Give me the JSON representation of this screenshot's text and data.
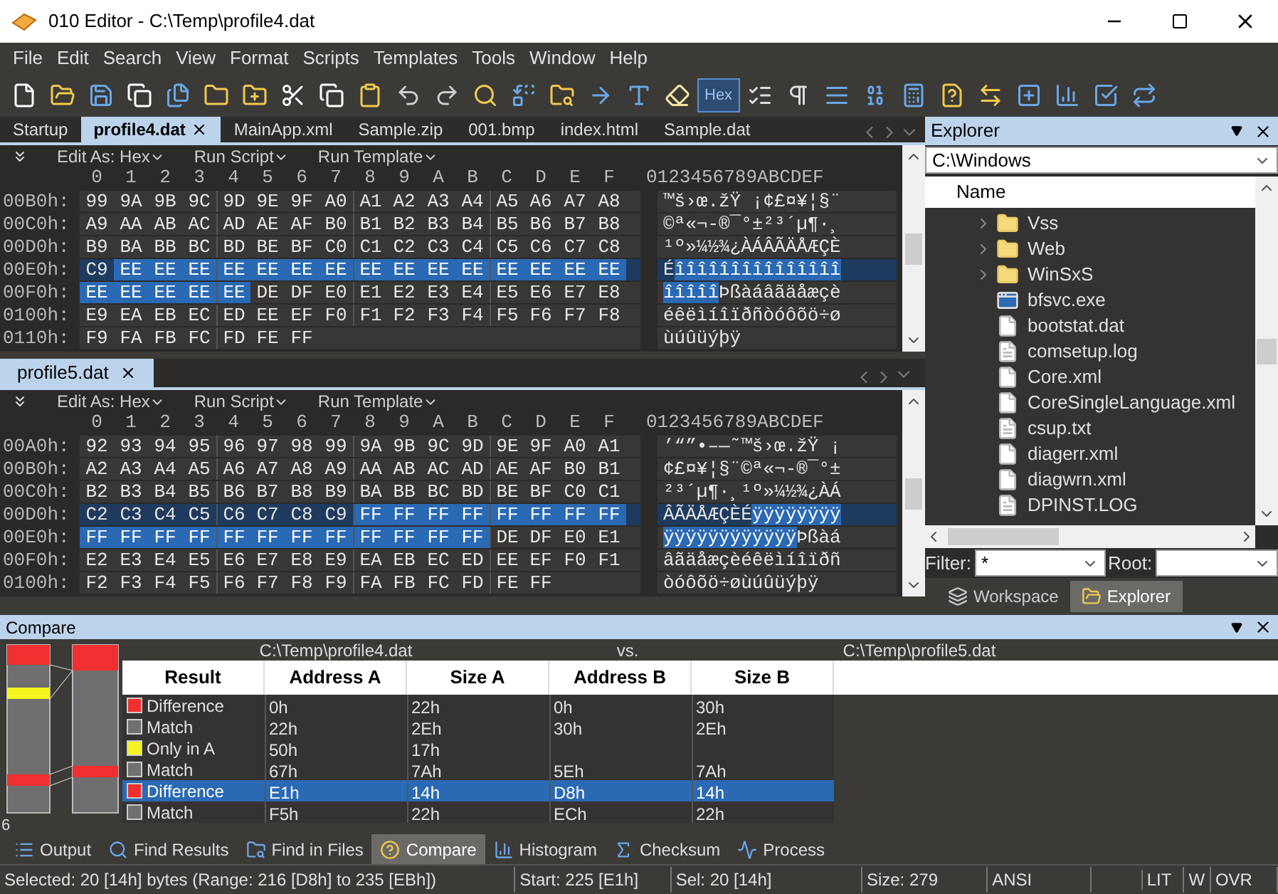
{
  "window": {
    "title": "010 Editor - C:\\Temp\\profile4.dat"
  },
  "menu": [
    "File",
    "Edit",
    "Search",
    "View",
    "Format",
    "Scripts",
    "Templates",
    "Tools",
    "Window",
    "Help"
  ],
  "toolbar": {
    "hex_toggle": {
      "label": "Hex",
      "selected": true
    }
  },
  "file_tabs": [
    {
      "label": "Startup",
      "selected": false
    },
    {
      "label": "profile4.dat",
      "selected": true
    },
    {
      "label": "MainApp.xml",
      "selected": false
    },
    {
      "label": "Sample.zip",
      "selected": false
    },
    {
      "label": "001.bmp",
      "selected": false
    },
    {
      "label": "index.html",
      "selected": false
    },
    {
      "label": "Sample.dat",
      "selected": false
    }
  ],
  "editors": [
    {
      "toolbar": [
        "Edit As: Hex",
        "Run Script",
        "Run Template"
      ],
      "columns": [
        "0",
        "1",
        "2",
        "3",
        "4",
        "5",
        "6",
        "7",
        "8",
        "9",
        "A",
        "B",
        "C",
        "D",
        "E",
        "F"
      ],
      "ascii_header": "0123456789ABCDEF",
      "rows": [
        {
          "address": "00B0h:",
          "current": false,
          "before": [
            "99",
            "9A",
            "9B",
            "9C",
            "9D",
            "9E",
            "9F",
            "A0",
            "A1",
            "A2",
            "A3",
            "A4",
            "A5",
            "A6",
            "A7",
            "A8"
          ],
          "highlighted": [],
          "after": [],
          "ascii_before": "™š›œ.žŸ ¡¢£¤¥¦§¨",
          "ascii_highlighted": "",
          "ascii_after": ""
        },
        {
          "address": "00C0h:",
          "current": false,
          "before": [
            "A9",
            "AA",
            "AB",
            "AC",
            "AD",
            "AE",
            "AF",
            "B0",
            "B1",
            "B2",
            "B3",
            "B4",
            "B5",
            "B6",
            "B7",
            "B8"
          ],
          "highlighted": [],
          "after": [],
          "ascii_before": "©ª«¬-®¯°±²³´µ¶·¸",
          "ascii_highlighted": "",
          "ascii_after": ""
        },
        {
          "address": "00D0h:",
          "current": false,
          "before": [
            "B9",
            "BA",
            "BB",
            "BC",
            "BD",
            "BE",
            "BF",
            "C0",
            "C1",
            "C2",
            "C3",
            "C4",
            "C5",
            "C6",
            "C7",
            "C8"
          ],
          "highlighted": [],
          "after": [],
          "ascii_before": "¹º»¼½¾¿ÀÁÂÃÄÅÆÇÈ",
          "ascii_highlighted": "",
          "ascii_after": ""
        },
        {
          "address": "00E0h:",
          "current": true,
          "before": [
            "C9"
          ],
          "highlighted": [
            "EE",
            "EE",
            "EE",
            "EE",
            "EE",
            "EE",
            "EE",
            "EE",
            "EE",
            "EE",
            "EE",
            "EE",
            "EE",
            "EE",
            "EE"
          ],
          "after": [],
          "ascii_before": "É",
          "ascii_highlighted": "îîîîîîîîîîîîîîî",
          "ascii_after": ""
        },
        {
          "address": "00F0h:",
          "current": false,
          "before": [],
          "highlighted": [
            "EE",
            "EE",
            "EE",
            "EE",
            "EE"
          ],
          "after": [
            "DE",
            "DF",
            "E0",
            "E1",
            "E2",
            "E3",
            "E4",
            "E5",
            "E6",
            "E7",
            "E8"
          ],
          "ascii_before": "",
          "ascii_highlighted": "îîîîî",
          "ascii_after": "Þßàáâãäåæçè"
        },
        {
          "address": "0100h:",
          "current": false,
          "before": [
            "E9",
            "EA",
            "EB",
            "EC",
            "ED",
            "EE",
            "EF",
            "F0",
            "F1",
            "F2",
            "F3",
            "F4",
            "F5",
            "F6",
            "F7",
            "F8"
          ],
          "highlighted": [],
          "after": [],
          "ascii_before": "éêëìíîïðñòóôõö÷ø",
          "ascii_highlighted": "",
          "ascii_after": ""
        },
        {
          "address": "0110h:",
          "current": false,
          "before": [
            "F9",
            "FA",
            "FB",
            "FC",
            "FD",
            "FE",
            "FF"
          ],
          "highlighted": [],
          "after": [],
          "ascii_before": "ùúûüýþÿ",
          "ascii_highlighted": "",
          "ascii_after": ""
        }
      ]
    },
    {
      "tab": {
        "label": "profile5.dat",
        "selected": true
      },
      "toolbar": [
        "Edit As: Hex",
        "Run Script",
        "Run Template"
      ],
      "columns": [
        "0",
        "1",
        "2",
        "3",
        "4",
        "5",
        "6",
        "7",
        "8",
        "9",
        "A",
        "B",
        "C",
        "D",
        "E",
        "F"
      ],
      "ascii_header": "0123456789ABCDEF",
      "rows": [
        {
          "address": "00A0h:",
          "current": false,
          "before": [
            "92",
            "93",
            "94",
            "95",
            "96",
            "97",
            "98",
            "99",
            "9A",
            "9B",
            "9C",
            "9D",
            "9E",
            "9F",
            "A0",
            "A1"
          ],
          "highlighted": [],
          "after": [],
          "ascii_before": "’“”•–—˜™š›œ.žŸ ¡",
          "ascii_highlighted": "",
          "ascii_after": ""
        },
        {
          "address": "00B0h:",
          "current": false,
          "before": [
            "A2",
            "A3",
            "A4",
            "A5",
            "A6",
            "A7",
            "A8",
            "A9",
            "AA",
            "AB",
            "AC",
            "AD",
            "AE",
            "AF",
            "B0",
            "B1"
          ],
          "highlighted": [],
          "after": [],
          "ascii_before": "¢£¤¥¦§¨©ª«¬-®¯°±",
          "ascii_highlighted": "",
          "ascii_after": ""
        },
        {
          "address": "00C0h:",
          "current": false,
          "before": [
            "B2",
            "B3",
            "B4",
            "B5",
            "B6",
            "B7",
            "B8",
            "B9",
            "BA",
            "BB",
            "BC",
            "BD",
            "BE",
            "BF",
            "C0",
            "C1"
          ],
          "highlighted": [],
          "after": [],
          "ascii_before": "²³´µ¶·¸¹º»¼½¾¿ÀÁ",
          "ascii_highlighted": "",
          "ascii_after": ""
        },
        {
          "address": "00D0h:",
          "current": true,
          "before": [
            "C2",
            "C3",
            "C4",
            "C5",
            "C6",
            "C7",
            "C8",
            "C9"
          ],
          "highlighted": [
            "FF",
            "FF",
            "FF",
            "FF",
            "FF",
            "FF",
            "FF",
            "FF"
          ],
          "after": [],
          "ascii_before": "ÂÃÄÅÆÇÈÉ",
          "ascii_highlighted": "ÿÿÿÿÿÿÿÿ",
          "ascii_after": ""
        },
        {
          "address": "00E0h:",
          "current": false,
          "before": [],
          "highlighted": [
            "FF",
            "FF",
            "FF",
            "FF",
            "FF",
            "FF",
            "FF",
            "FF",
            "FF",
            "FF",
            "FF",
            "FF"
          ],
          "after": [
            "DE",
            "DF",
            "E0",
            "E1"
          ],
          "ascii_before": "",
          "ascii_highlighted": "ÿÿÿÿÿÿÿÿÿÿÿÿ",
          "ascii_after": "Þßàá"
        },
        {
          "address": "00F0h:",
          "current": false,
          "before": [
            "E2",
            "E3",
            "E4",
            "E5",
            "E6",
            "E7",
            "E8",
            "E9",
            "EA",
            "EB",
            "EC",
            "ED",
            "EE",
            "EF",
            "F0",
            "F1"
          ],
          "highlighted": [],
          "after": [],
          "ascii_before": "âãäåæçèéêëìíîïðñ",
          "ascii_highlighted": "",
          "ascii_after": ""
        },
        {
          "address": "0100h:",
          "current": false,
          "before": [
            "F2",
            "F3",
            "F4",
            "F5",
            "F6",
            "F7",
            "F8",
            "F9",
            "FA",
            "FB",
            "FC",
            "FD",
            "FE",
            "FF"
          ],
          "highlighted": [],
          "after": [],
          "ascii_before": "òóôõö÷øùúûüýþÿ",
          "ascii_highlighted": "",
          "ascii_after": ""
        }
      ]
    }
  ],
  "explorer": {
    "title": "Explorer",
    "path": "C:\\Windows",
    "column": "Name",
    "items": [
      {
        "name": "Vss",
        "kind": "folder"
      },
      {
        "name": "Web",
        "kind": "folder"
      },
      {
        "name": "WinSxS",
        "kind": "folder"
      },
      {
        "name": "bfsvc.exe",
        "kind": "app"
      },
      {
        "name": "bootstat.dat",
        "kind": "file"
      },
      {
        "name": "comsetup.log",
        "kind": "text"
      },
      {
        "name": "Core.xml",
        "kind": "file"
      },
      {
        "name": "CoreSingleLanguage.xml",
        "kind": "file"
      },
      {
        "name": "csup.txt",
        "kind": "text"
      },
      {
        "name": "diagerr.xml",
        "kind": "file"
      },
      {
        "name": "diagwrn.xml",
        "kind": "file"
      },
      {
        "name": "DPINST.LOG",
        "kind": "text"
      }
    ],
    "filter_label": "Filter:",
    "filter_value": "*",
    "root_label": "Root:",
    "tabs": [
      {
        "label": "Workspace",
        "selected": false
      },
      {
        "label": "Explorer",
        "selected": true
      }
    ]
  },
  "compare": {
    "title": "Compare",
    "file_a": "C:\\Temp\\profile4.dat",
    "vs": "vs.",
    "file_b": "C:\\Temp\\profile5.dat",
    "columns": [
      "Result",
      "Address A",
      "Size A",
      "Address B",
      "Size B"
    ],
    "rows": [
      {
        "result": "Difference",
        "color": "#f03030",
        "address_a": "0h",
        "size_a": "22h",
        "address_b": "0h",
        "size_b": "30h",
        "selected": false
      },
      {
        "result": "Match",
        "color": "#707070",
        "address_a": "22h",
        "size_a": "2Eh",
        "address_b": "30h",
        "size_b": "2Eh",
        "selected": false
      },
      {
        "result": "Only in A",
        "color": "#f5f520",
        "address_a": "50h",
        "size_a": "17h",
        "address_b": "",
        "size_b": "",
        "selected": false
      },
      {
        "result": "Match",
        "color": "#707070",
        "address_a": "67h",
        "size_a": "7Ah",
        "address_b": "5Eh",
        "size_b": "7Ah",
        "selected": false
      },
      {
        "result": "Difference",
        "color": "#f03030",
        "address_a": "E1h",
        "size_a": "14h",
        "address_b": "D8h",
        "size_b": "14h",
        "selected": true
      },
      {
        "result": "Match",
        "color": "#707070",
        "address_a": "F5h",
        "size_a": "22h",
        "address_b": "ECh",
        "size_b": "22h",
        "selected": false
      }
    ],
    "count": "6"
  },
  "bottom_tabs": [
    {
      "label": "Output",
      "selected": false
    },
    {
      "label": "Find Results",
      "selected": false
    },
    {
      "label": "Find in Files",
      "selected": false
    },
    {
      "label": "Compare",
      "selected": true
    },
    {
      "label": "Histogram",
      "selected": false
    },
    {
      "label": "Checksum",
      "selected": false
    },
    {
      "label": "Process",
      "selected": false
    }
  ],
  "status_bar": [
    "Selected: 20 [14h] bytes (Range: 216 [D8h] to 235 [EBh])",
    "Start: 225 [E1h]",
    "Sel: 20 [14h]",
    "Size: 279",
    "ANSI",
    "LIT",
    "W",
    "OVR"
  ]
}
